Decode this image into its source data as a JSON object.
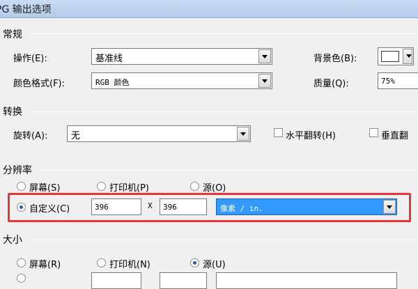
{
  "window": {
    "title": "PG 输出选项"
  },
  "general": {
    "label": "常规",
    "operation": {
      "label": "操作(E):",
      "value": "基准线"
    },
    "color_format": {
      "label": "颜色格式(F):",
      "value": "RGB 颜色"
    },
    "background": {
      "label": "背景色(B):"
    },
    "quality": {
      "label": "质量(Q):",
      "value": "75%"
    }
  },
  "transform": {
    "label": "转换",
    "rotate": {
      "label": "旋转(A):",
      "value": "无"
    },
    "flip_h": {
      "label": "水平翻转(H)",
      "checked": false
    },
    "flip_v": {
      "label": "垂直翻",
      "checked": false
    }
  },
  "resolution": {
    "label": "分辨率",
    "options": [
      {
        "label": "屏幕(S)",
        "checked": false
      },
      {
        "label": "打印机(P)",
        "checked": false
      },
      {
        "label": "源(O)",
        "checked": false
      },
      {
        "label": "自定义(C)",
        "checked": true
      }
    ],
    "x_value": "396",
    "x_sep": "X",
    "y_value": "396",
    "unit": "像素 / in."
  },
  "size": {
    "label": "大小",
    "options": [
      {
        "label": "屏幕(R)",
        "checked": false
      },
      {
        "label": "打印机(N)",
        "checked": false
      },
      {
        "label": "源(U)",
        "checked": true
      }
    ]
  },
  "colors": {
    "accent": "#3399ff",
    "highlight": "#e8343a"
  }
}
